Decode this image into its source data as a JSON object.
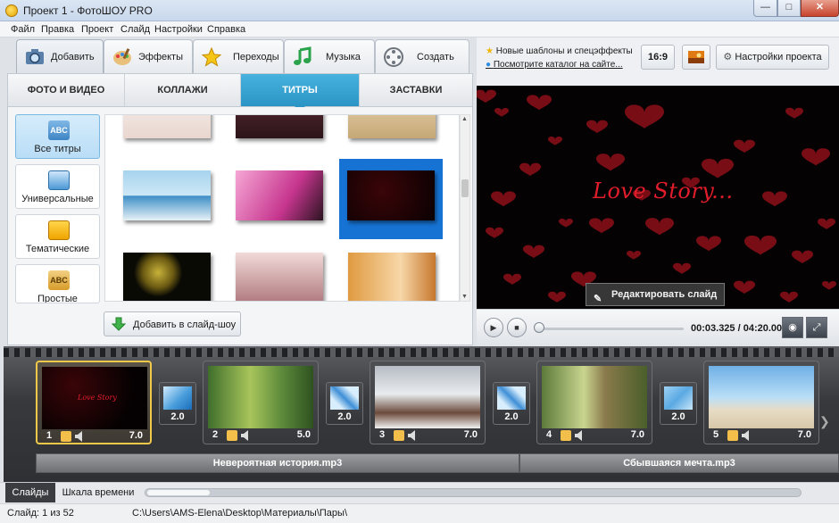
{
  "window": {
    "title": "Проект 1 - ФотоШОУ PRO"
  },
  "menu": [
    "Файл",
    "Правка",
    "Проект",
    "Слайд",
    "Настройки",
    "Справка"
  ],
  "main_tabs": [
    {
      "label": "Добавить",
      "icon": "camera-icon"
    },
    {
      "label": "Эффекты",
      "icon": "palette-icon"
    },
    {
      "label": "Переходы",
      "icon": "star-icon"
    },
    {
      "label": "Музыка",
      "icon": "music-note-icon"
    },
    {
      "label": "Создать",
      "icon": "film-reel-icon"
    }
  ],
  "sub_tabs": [
    "ФОТО И ВИДЕО",
    "КОЛЛАЖИ",
    "ТИТРЫ",
    "ЗАСТАВКИ"
  ],
  "categories": [
    {
      "label": "Все титры",
      "badge": "ABC"
    },
    {
      "label": "Универсальные"
    },
    {
      "label": "Тематические"
    },
    {
      "label": "Простые",
      "badge": "ABC"
    }
  ],
  "add_button": {
    "label": "Добавить в слайд-шоу"
  },
  "news": {
    "line1": "Новые шаблоны и спецэффекты",
    "line2": "Посмотрите каталог на сайте..."
  },
  "toolbar": {
    "aspect": "16:9",
    "project_settings": "Настройки проекта"
  },
  "preview": {
    "title_text": "Love Story...",
    "edit_button": "Редактировать слайд"
  },
  "player": {
    "time": "00:03.325 / 04:20.000",
    "progress": 0.013
  },
  "slides": [
    {
      "num": "1",
      "dur": "7.0"
    },
    {
      "num": "2",
      "dur": "5.0"
    },
    {
      "num": "3",
      "dur": "7.0"
    },
    {
      "num": "4",
      "dur": "7.0"
    },
    {
      "num": "5",
      "dur": "7.0"
    }
  ],
  "slide1_text": "Love Story",
  "transitions": [
    "2.0",
    "2.0",
    "2.0",
    "2.0"
  ],
  "audio": [
    "Невероятная история.mp3",
    "Сбывшаяся мечта.mp3"
  ],
  "bottom_tabs": [
    "Слайды",
    "Шкала времени"
  ],
  "status": {
    "slide_count": "Слайд: 1 из 52",
    "path": "C:\\Users\\AMS-Elena\\Desktop\\Материалы\\Пары\\"
  },
  "colors": {
    "accent": "#2b94c5",
    "active_slide": "#f0c94a",
    "love_text": "#e21d2b"
  }
}
